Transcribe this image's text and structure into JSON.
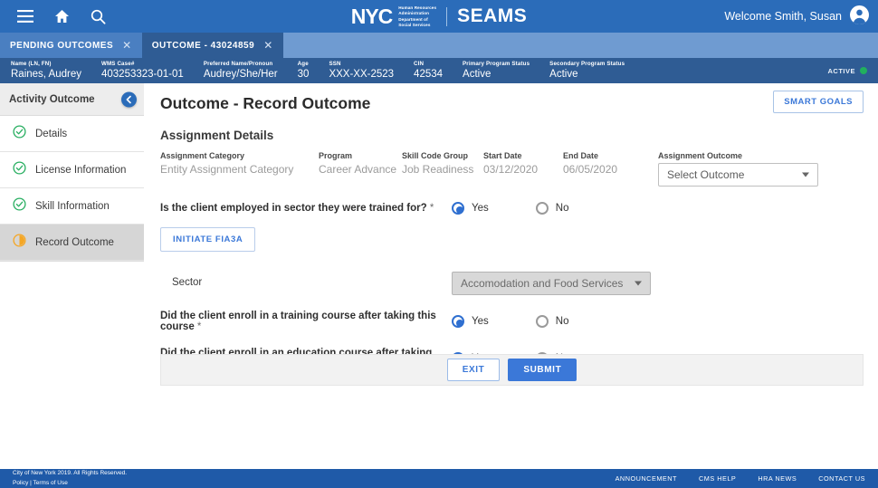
{
  "topbar": {
    "menu_icon": "hamburger-menu-icon",
    "home_icon": "home-icon",
    "search_icon": "search-icon",
    "logo_text": "NYC",
    "agency_line1": "Human Resources",
    "agency_line2": "Administration",
    "agency_line3": "Department of",
    "agency_line4": "Social Services",
    "app_name": "SEAMS",
    "welcome": "Welcome Smith, Susan",
    "avatar_icon": "user-account-icon"
  },
  "tabs": [
    {
      "label": "PENDING OUTCOMES",
      "close": "✕",
      "active": false
    },
    {
      "label": "OUTCOME - 43024859",
      "close": "✕",
      "active": true
    }
  ],
  "client_bar": {
    "fields": [
      {
        "label": "Name (LN, FN)",
        "value": "Raines, Audrey"
      },
      {
        "label": "WMS Case#",
        "value": "403253323-01-01"
      },
      {
        "label": "Preferred Name/Pronoun",
        "value": "Audrey/She/Her"
      },
      {
        "label": "Age",
        "value": "30"
      },
      {
        "label": "SSN",
        "value": "XXX-XX-2523"
      },
      {
        "label": "CIN",
        "value": "42534"
      },
      {
        "label": "Primary Program Status",
        "value": "Active"
      },
      {
        "label": "Secondary Program Status",
        "value": "Active"
      }
    ],
    "status_text": "ACTIVE",
    "status_color": "#21b05e"
  },
  "sidebar": {
    "title": "Activity Outcome",
    "collapse_icon": "chevron-left-icon",
    "items": [
      {
        "label": "Details",
        "icon": "check-circle-icon",
        "state": "complete"
      },
      {
        "label": "License Information",
        "icon": "check-circle-icon",
        "state": "complete"
      },
      {
        "label": "Skill Information",
        "icon": "check-circle-icon",
        "state": "complete"
      },
      {
        "label": "Record Outcome",
        "icon": "half-circle-progress-icon",
        "state": "current"
      }
    ]
  },
  "main": {
    "page_title": "Outcome - Record Outcome",
    "smart_goals_label": "SMART GOALS",
    "section_title": "Assignment Details",
    "assignment": [
      {
        "label": "Assignment Category",
        "value": "Entity Assignment Category"
      },
      {
        "label": "Program",
        "value": "Career Advance"
      },
      {
        "label": "Skill Code Group",
        "value": "Job Readiness"
      },
      {
        "label": "Start Date",
        "value": "03/12/2020"
      },
      {
        "label": "End Date",
        "value": "06/05/2020"
      }
    ],
    "assignment_outcome": {
      "label": "Assignment Outcome",
      "value": "Select Outcome",
      "caret_icon": "chevron-down-icon"
    },
    "questions": [
      {
        "text": "Is the client employed in sector they were trained for?",
        "required": "*",
        "yes_label": "Yes",
        "no_label": "No",
        "selected": "Yes"
      },
      {
        "text": "Did the client enroll in a training course after taking this course",
        "required": "*",
        "yes_label": "Yes",
        "no_label": "No",
        "selected": "Yes"
      },
      {
        "text": "Did the client enroll in an education course after taking this course",
        "required": "*",
        "yes_label": "Yes",
        "no_label": "No",
        "selected": "Yes"
      }
    ],
    "initiate_button": "INITIATE FIA3A",
    "sector": {
      "label": "Sector",
      "value": "Accomodation and Food Services",
      "disabled": true,
      "caret_icon": "chevron-down-icon"
    },
    "exit_label": "EXIT",
    "submit_label": "SUBMIT"
  },
  "footer": {
    "copyright": "City of New York 2019. All Rights Reserved.",
    "policy": "Policy",
    "separator": " | ",
    "terms": "Terms of Use",
    "links": [
      "ANNOUNCEMENT",
      "CMS HELP",
      "HRA NEWS",
      "CONTACT US"
    ]
  },
  "colors": {
    "brand_blue": "#2b6cb9",
    "tab_active": "#2f5c94",
    "accent_blue": "#3b78d8",
    "footer_blue": "#1f5aa8",
    "status_green": "#21b05e",
    "progress_orange": "#f5a623"
  }
}
